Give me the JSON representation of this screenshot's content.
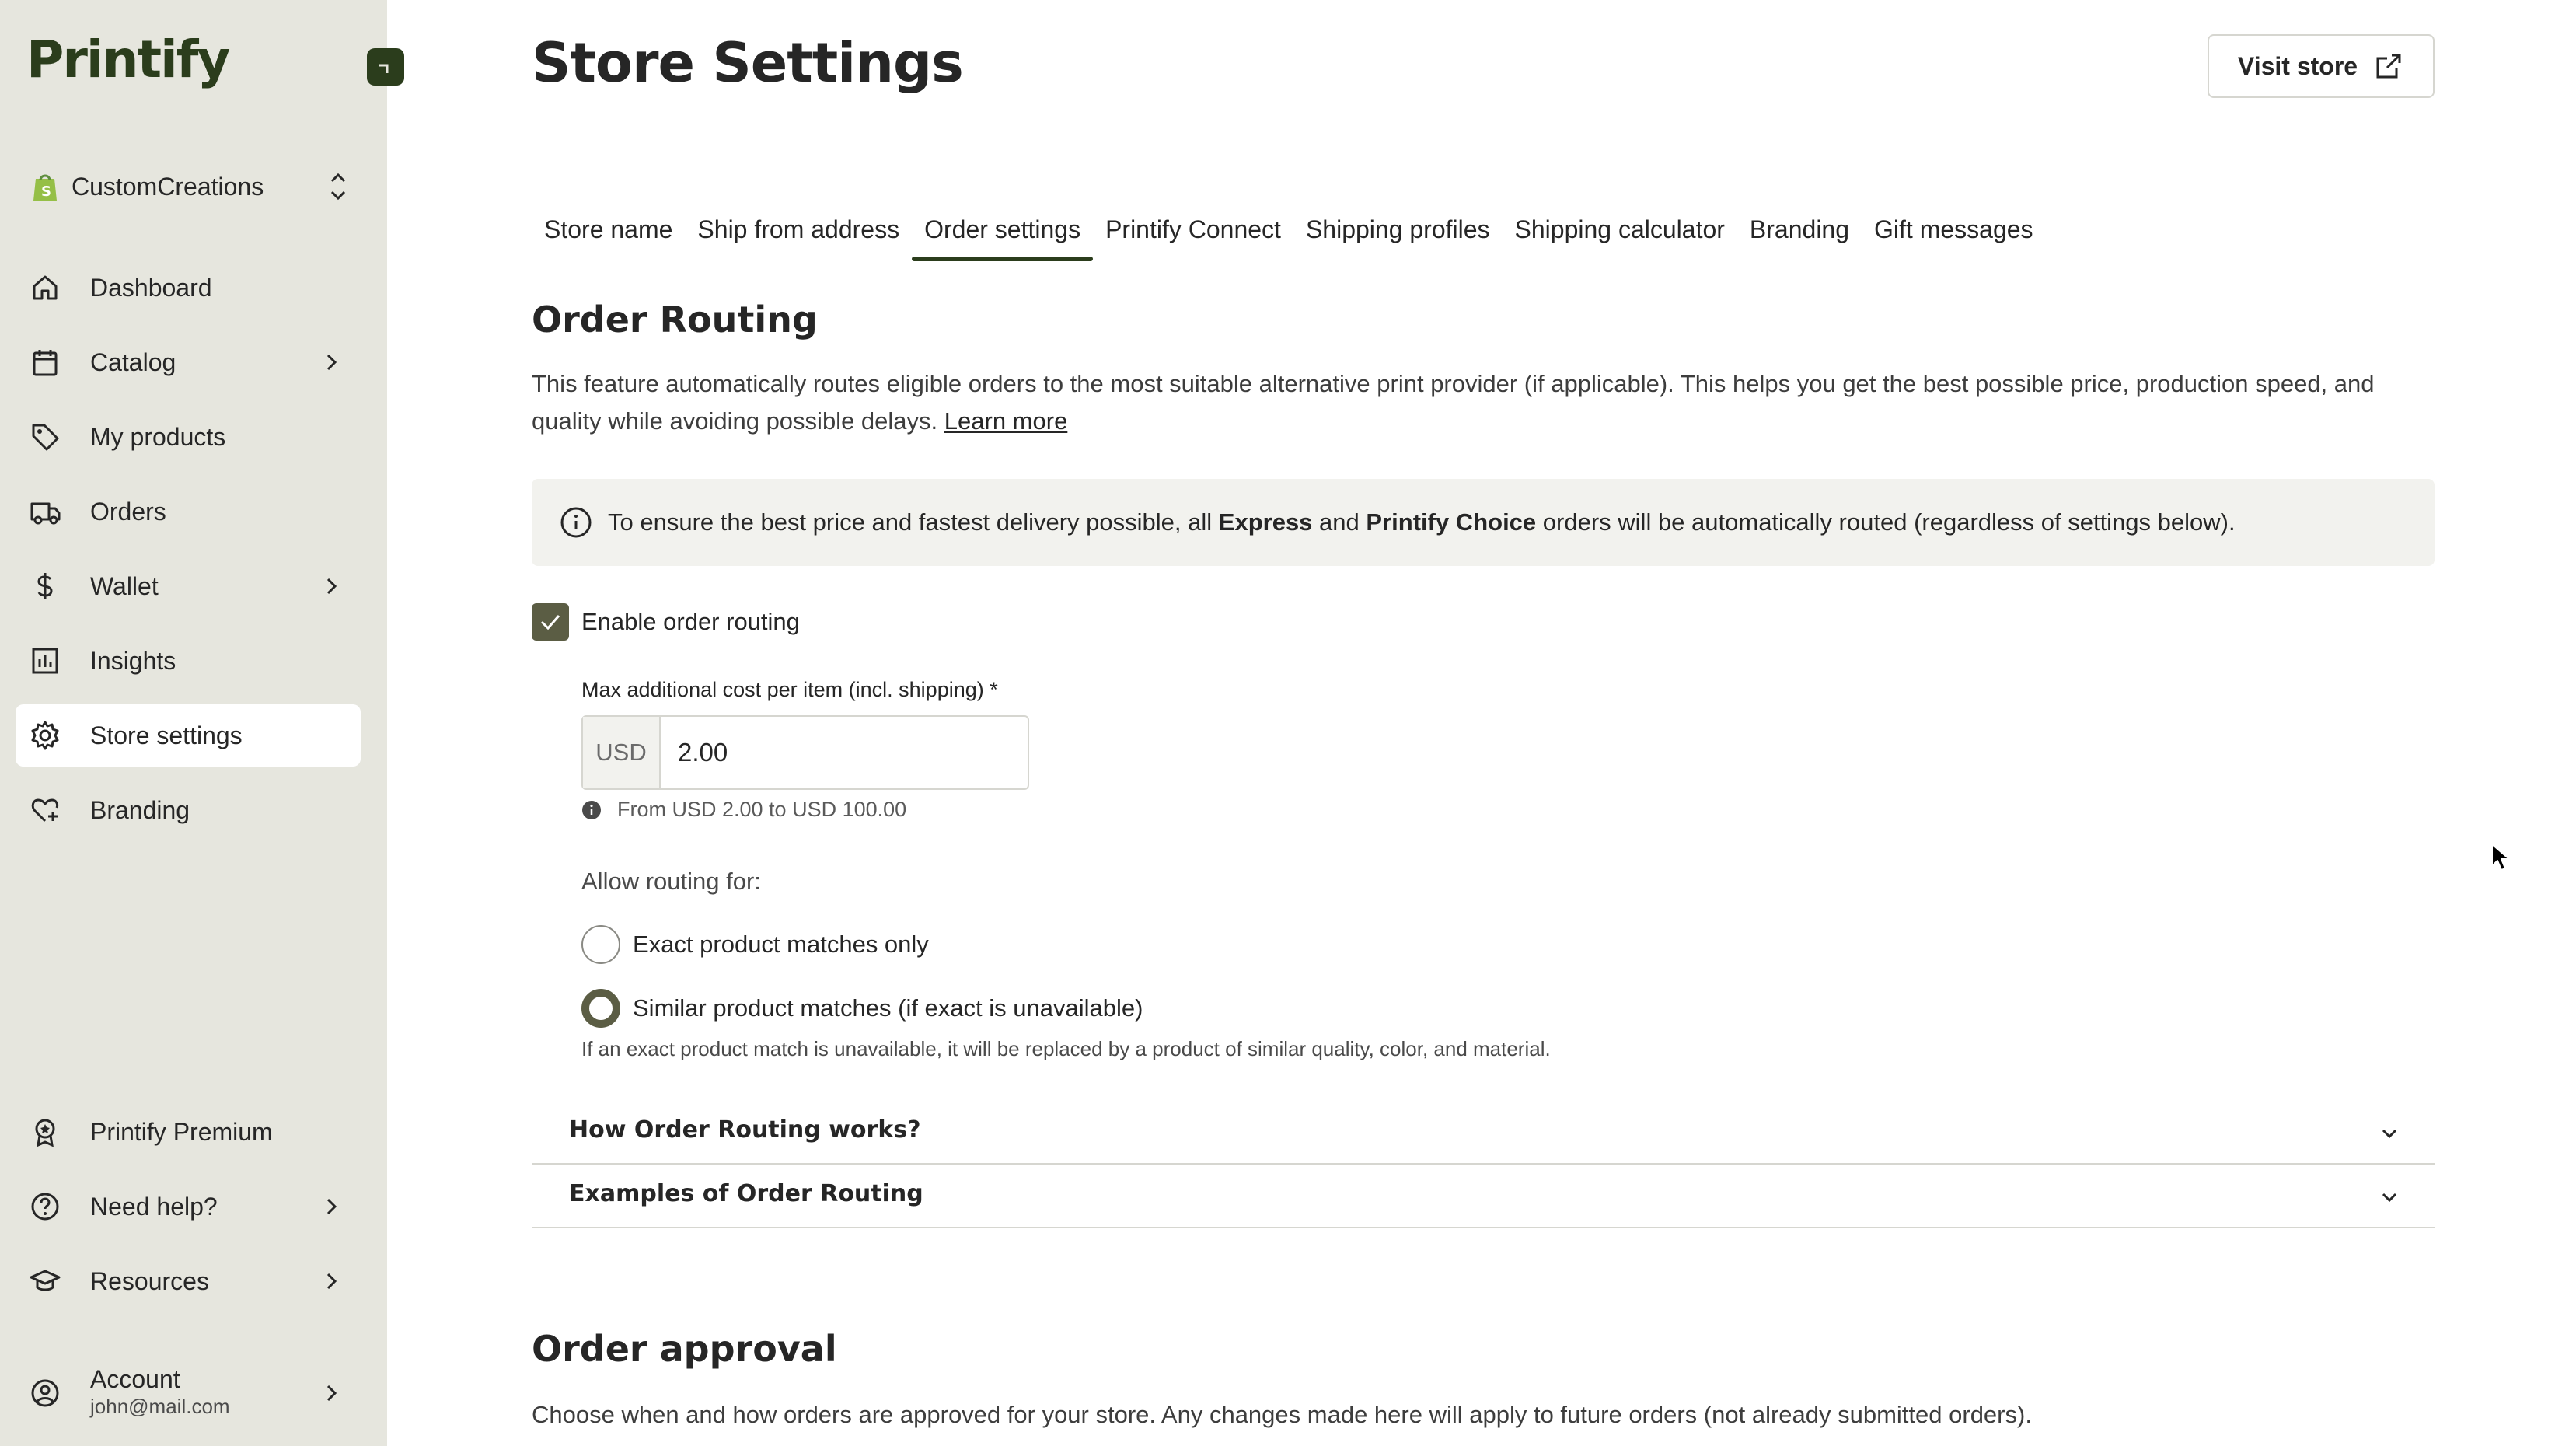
{
  "app": {
    "brand": "Printify"
  },
  "sidebar": {
    "store_name": "CustomCreations",
    "items": [
      {
        "label": "Dashboard",
        "icon": "home-icon"
      },
      {
        "label": "Catalog",
        "icon": "clipboard-icon"
      },
      {
        "label": "My products",
        "icon": "tag-icon"
      },
      {
        "label": "Orders",
        "icon": "truck-icon"
      },
      {
        "label": "Wallet",
        "icon": "dollar-icon"
      },
      {
        "label": "Insights",
        "icon": "chart-icon"
      },
      {
        "label": "Store settings",
        "icon": "gear-icon"
      },
      {
        "label": "Branding",
        "icon": "heart-plus-icon"
      }
    ],
    "bottom_items": [
      {
        "label": "Printify Premium",
        "icon": "award-icon"
      },
      {
        "label": "Need help?",
        "icon": "help-icon"
      },
      {
        "label": "Resources",
        "icon": "graduation-icon"
      }
    ],
    "account": {
      "label": "Account",
      "email": "john@mail.com"
    }
  },
  "header": {
    "title": "Store Settings",
    "visit_store": "Visit store"
  },
  "tabs": [
    "Store name",
    "Ship from address",
    "Order settings",
    "Printify Connect",
    "Shipping profiles",
    "Shipping calculator",
    "Branding",
    "Gift messages"
  ],
  "active_tab": "Order settings",
  "order_routing": {
    "title": "Order Routing",
    "description": "This feature automatically routes eligible orders to the most suitable alternative print provider (if applicable). This helps you get the best possible price, production speed, and quality while avoiding possible delays.",
    "learn_more": "Learn more",
    "info_pre": "To ensure the best price and fastest delivery possible, all",
    "info_express": "Express",
    "info_and": "and",
    "info_choice": "Printify Choice",
    "info_post": "orders will be automatically routed (regardless of settings below).",
    "enable_label": "Enable order routing",
    "enabled": true,
    "max_cost_label": "Max additional cost per item (incl. shipping) *",
    "currency": "USD",
    "max_cost_value": "2.00",
    "range_hint": "From USD 2.00 to USD 100.00",
    "allow_label": "Allow routing for:",
    "option_exact": "Exact product matches only",
    "option_similar": "Similar product matches (if exact is unavailable)",
    "selected_option": "similar",
    "similar_desc": "If an exact product match is unavailable, it will be replaced by a product of similar quality, color, and material.",
    "faq_1": "How Order Routing works?",
    "faq_2": "Examples of Order Routing"
  },
  "order_approval": {
    "title": "Order approval",
    "description": "Choose when and how orders are approved for your store. Any changes made here will apply to future orders (not already submitted orders)."
  },
  "colors": {
    "brand": "#2b3d1c",
    "sidebar_bg": "#e6e6de",
    "accent_olive": "#5b5d44",
    "shopify_green": "#95bf47"
  }
}
